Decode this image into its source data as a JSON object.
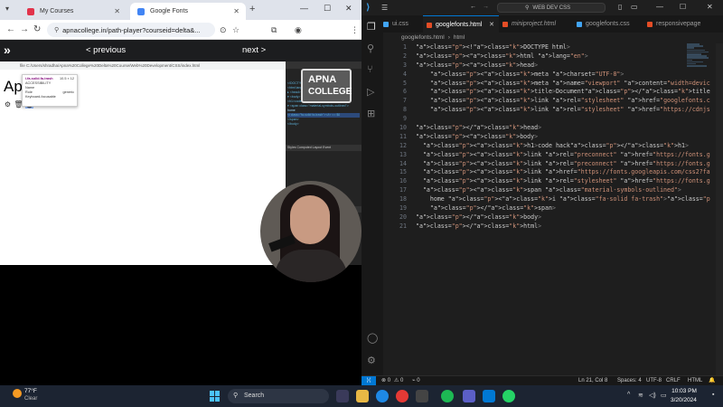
{
  "browser": {
    "tabs": [
      {
        "label": "My Courses",
        "color": "#e2334b"
      },
      {
        "label": "Google Fonts",
        "color": "#4285f4"
      }
    ],
    "url": "apnacollege.in/path-player?courseid=delta&...",
    "player": {
      "prev_label": "< previous",
      "next_label": "next >"
    },
    "file_path": "file   C:/Users/shradha/Apna%20College%20Delta%20Course/Web%20Development/CSS/index.html",
    "page_heading": "Apr",
    "tooltip": {
      "title": "i.fa-solid.fa-trash",
      "size": "10.5 × 12",
      "sec": "ACCESSIBILITY",
      "name_label": "Name",
      "role_label": "Role",
      "role_value": "generic",
      "kb_label": "Keyboard-focusable"
    },
    "devtools": {
      "elements_tab": "Elements",
      "lines": [
        "<!DOCTYPE html>",
        "<html lang=\"en\">",
        "▸ <head> … </head>",
        "▾ <body>",
        "  <h1>code hack</h1>",
        "  ▾ <span class=\"material-symbols-outlined\">",
        "    home",
        "    <i class=\"fa-solid fa-trash\"></i> == $0",
        "  </span>",
        "</body>"
      ],
      "panel_tabs": "Styles   Computed   Layout   Event",
      "filter": "Filter        :hov  .cls  +"
    },
    "apna_logo": {
      "line1": "APNA",
      "line2": "COLLEGE"
    }
  },
  "vscode": {
    "menu": "☰",
    "search_text": "WEB DEV CSS",
    "tabs": [
      {
        "label": "ui.css",
        "color": "#42a5f5",
        "italic": false
      },
      {
        "label": "googlefonts.html",
        "color": "#e44d26",
        "italic": false
      },
      {
        "label": "miniproject.html",
        "color": "#e44d26",
        "italic": true
      },
      {
        "label": "googlefonts.css",
        "color": "#42a5f5",
        "italic": false
      },
      {
        "label": "responsivepage",
        "color": "#e44d26",
        "italic": false
      }
    ],
    "breadcrumb": {
      "file": "googlefonts.html",
      "node": "html"
    },
    "code_lines": [
      "<!DOCTYPE html>",
      "<html lang=\"en\">",
      "<head>",
      "    <meta charset=\"UTF-8\">",
      "    <meta name=\"viewport\" content=\"width=device-width, initial-scale=1.0\">",
      "    <title>Document</title>",
      "    <link rel=\"stylesheet\" href=\"googlefonts.css\">",
      "    <link rel=\"stylesheet\" href=\"https://cdnjs.cloudflare.com/ajax/libs/fo",
      "",
      "</head>",
      "<body>",
      "  <h1>code hack</h1>",
      "  <link rel=\"preconnect\" href=\"https://fonts.googleapis.com\">",
      "  <link rel=\"preconnect\" href=\"https://fonts.gstatic.com\" crossorigin>",
      "  <link href=\"https://fonts.googleapis.com/css2?family=Happy+Monkey&family=",
      "  <link rel=\"stylesheet\" href=\"https://fonts.googleapis.com/css2?family=Mat",
      "  <span class=\"material-symbols-outlined\">",
      "    home <i class=\"fa-solid fa-trash\"></i>",
      "    </span>",
      "</body>",
      "</html>"
    ],
    "status": {
      "errors": "⊗ 0",
      "warnings": "⚠ 0",
      "ports": "⌁ 0",
      "cursor": "Ln 21, Col 8",
      "spaces": "Spaces: 4",
      "encoding": "UTF-8",
      "eol": "CRLF",
      "language": "HTML"
    }
  },
  "taskbar": {
    "temperature": "77°F",
    "condition": "Clear",
    "search_label": "Search",
    "time": "10:03 PM",
    "date": "3/20/2024"
  }
}
